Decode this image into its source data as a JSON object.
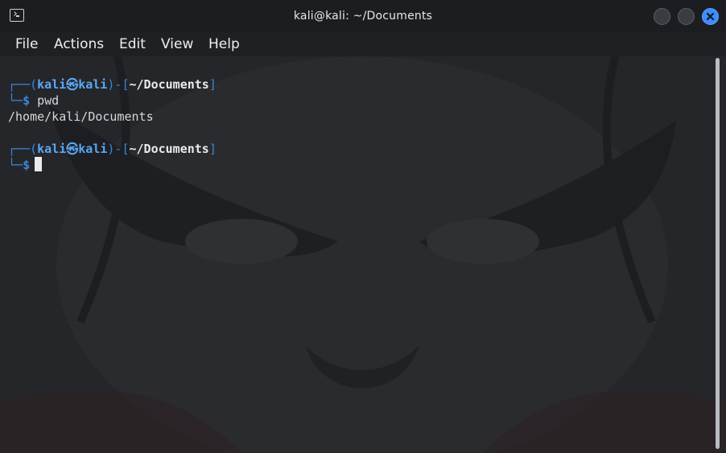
{
  "window": {
    "title": "kali@kali: ~/Documents",
    "app_icon": "terminal-icon",
    "controls": [
      "minimize-button",
      "maximize-button",
      "close-button"
    ],
    "accent_color": "#3d8cf7"
  },
  "menu": {
    "items": [
      "File",
      "Actions",
      "Edit",
      "View",
      "Help"
    ]
  },
  "terminal": {
    "prompt1": {
      "box_top": "┌──(",
      "user": "kali",
      "at_symbol": "㉿",
      "host": "kali",
      "mid": ")-[",
      "path": "~/Documents",
      "close": "]",
      "box_bottom": "└─",
      "dollar": "$",
      "command": " pwd"
    },
    "output": "/home/kali/Documents",
    "prompt2": {
      "box_top": "┌──(",
      "user": "kali",
      "at_symbol": "㉿",
      "host": "kali",
      "mid": ")-[",
      "path": "~/Documents",
      "close": "]",
      "box_bottom": "└─",
      "dollar": "$"
    }
  }
}
